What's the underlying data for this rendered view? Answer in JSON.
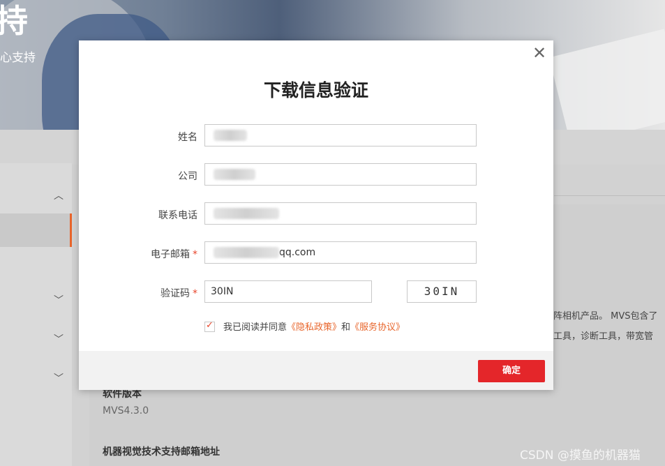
{
  "hero": {
    "title": "持",
    "subtitle": "心支持"
  },
  "background": {
    "line1": "阵相机产品。 MVS包含了",
    "line2": "工具，诊断工具，带宽管",
    "software_version_label": "软件版本",
    "software_version_value": "MVS4.3.0",
    "email_heading": "机器视觉技术支持邮箱地址",
    "watermark": "CSDN @摸鱼的机器猫"
  },
  "modal": {
    "title": "下载信息验证",
    "close_icon": "close-icon",
    "fields": {
      "name": {
        "label": "姓名",
        "value": ""
      },
      "company": {
        "label": "公司",
        "value": ""
      },
      "phone": {
        "label": "联系电话",
        "value": ""
      },
      "email": {
        "label": "电子邮箱",
        "required": "*",
        "value": "qq.com"
      },
      "captcha": {
        "label": "验证码",
        "required": "*",
        "value": "30IN",
        "image_text": "30IN"
      }
    },
    "agreement": {
      "checked": true,
      "text": "我已阅读并同意",
      "privacy_link": "《隐私政策》",
      "and": "和",
      "service_link": "《服务协议》"
    },
    "confirm_label": "确定"
  },
  "colors": {
    "accent": "#e4262a",
    "link": "#e8652b"
  }
}
